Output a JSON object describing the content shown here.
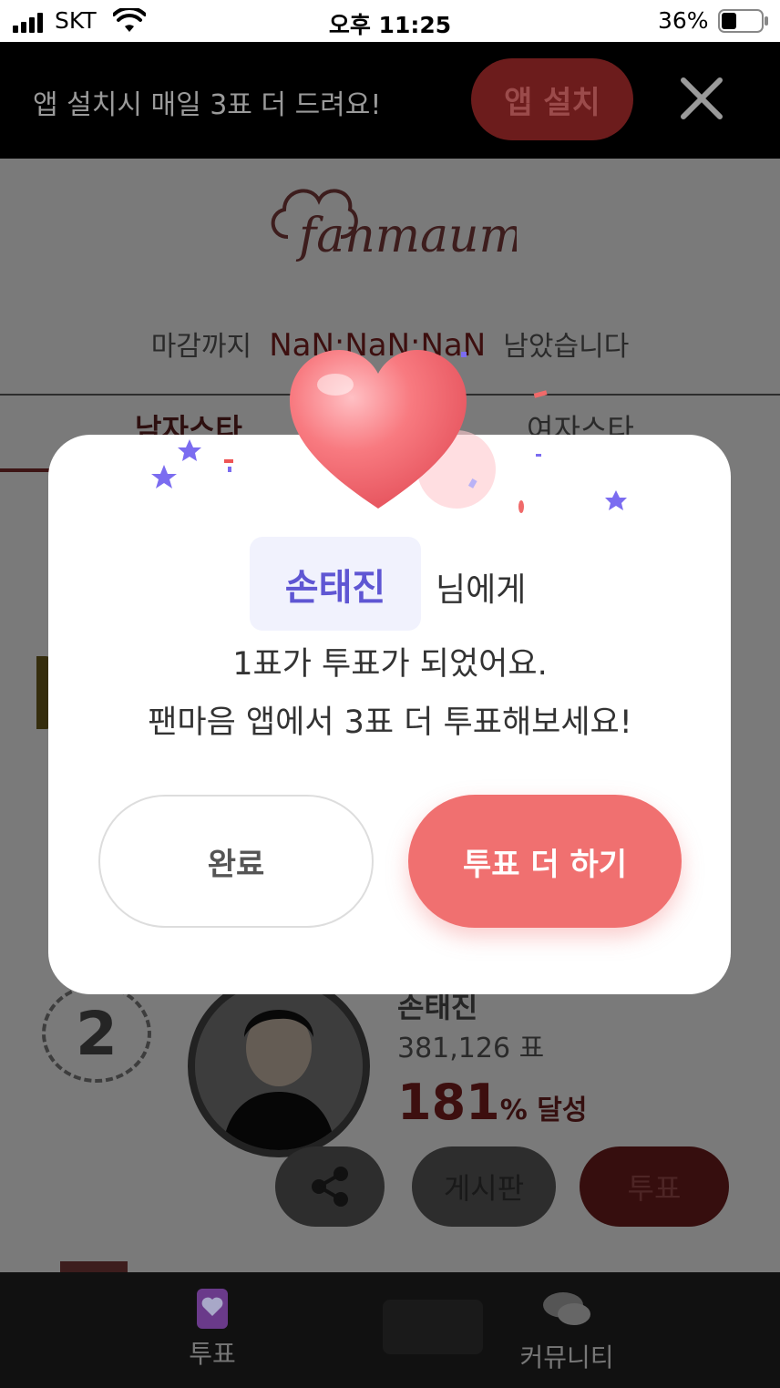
{
  "status_bar": {
    "carrier": "SKT",
    "time": "오후 11:25",
    "battery": "36%"
  },
  "app_banner": {
    "text": "앱 설치시 매일 3표 더 드려요!",
    "install_label": "앱 설치"
  },
  "page": {
    "countdown_prefix": "마감까지",
    "countdown_value": "NaN:NaN:NaN",
    "countdown_suffix": "남았습니다",
    "tabs": [
      "남자스타",
      "여자스타"
    ],
    "star": {
      "rank": "2",
      "name": "손태진",
      "votes": "381,126 표",
      "percent": "181",
      "percent_unit": "% 달성"
    },
    "board_label": "게시판",
    "vote_label": "투표"
  },
  "bottom_nav": {
    "vote_label": "투표",
    "community_label": "커뮤니티"
  },
  "modal": {
    "name": "손태진",
    "name_suffix": "님에게",
    "line1": "1표가 투표가 되었어요.",
    "line2": "팬마음 앱에서 3표 더 투표해보세요!",
    "done_label": "완료",
    "more_label": "투표 더 하기"
  },
  "colors": {
    "accent": "#f07070",
    "name_highlight": "#5f56d3",
    "name_bg": "#f1f2fd"
  }
}
